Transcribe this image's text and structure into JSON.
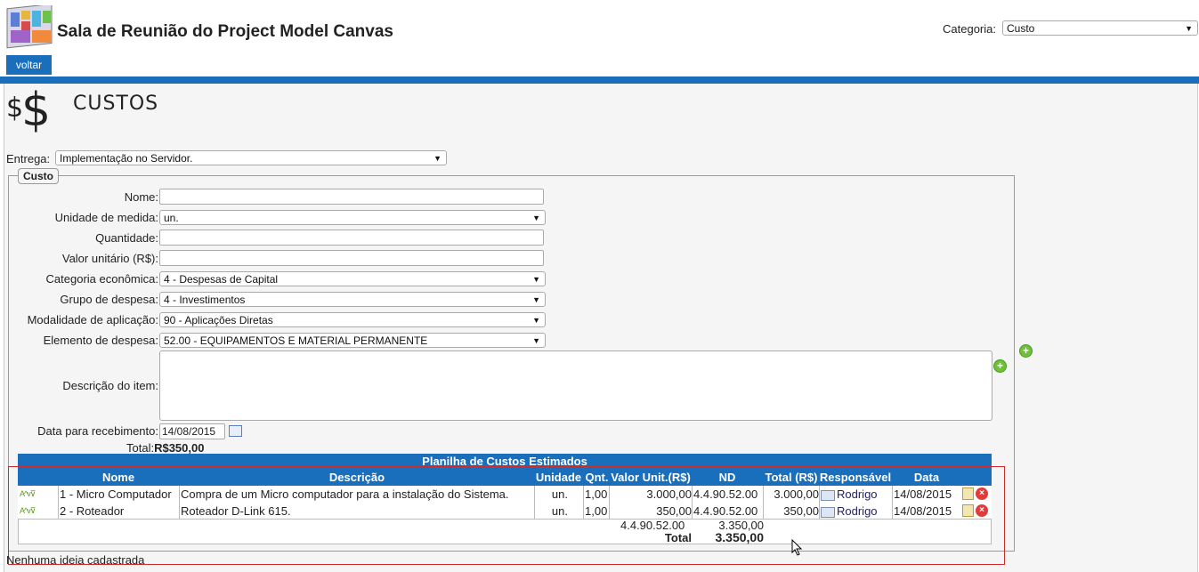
{
  "header": {
    "title": "Sala de Reunião do Project Model Canvas",
    "category_label": "Categoria:",
    "category_value": "Custo",
    "back_button": "voltar"
  },
  "section": {
    "title": "CUSTOS",
    "entrega_label": "Entrega:",
    "entrega_value": "Implementação no Servidor."
  },
  "form": {
    "legend": "Custo",
    "nome_label": "Nome:",
    "unidade_label": "Unidade de medida:",
    "unidade_value": "un.",
    "quantidade_label": "Quantidade:",
    "valor_label": "Valor unitário (R$):",
    "categoria_label": "Categoria econômica:",
    "categoria_value": "4 - Despesas de Capital",
    "grupo_label": "Grupo de despesa:",
    "grupo_value": "4 - Investimentos",
    "modalidade_label": "Modalidade de aplicação:",
    "modalidade_value": "90 - Aplicações Diretas",
    "elemento_label": "Elemento de despesa:",
    "elemento_value": "52.00 - EQUIPAMENTOS E MATERIAL PERMANENTE",
    "descricao_label": "Descrição do item:",
    "data_label": "Data para recebimento:",
    "data_value": "14/08/2015",
    "total_label": "Total:",
    "total_value": "R$350,00"
  },
  "table": {
    "title": "Planilha de Custos Estimados",
    "headers": {
      "nome": "Nome",
      "descricao": "Descrição",
      "unidade": "Unidade",
      "qnt": "Qnt.",
      "valor": "Valor Unit.(R$)",
      "nd": "ND",
      "total": "Total (R$)",
      "responsavel": "Responsável",
      "data": "Data"
    },
    "rows": [
      {
        "nome": "1 - Micro Computador",
        "descricao": "Compra de um Micro computador para a instalação do Sistema.",
        "unidade": "un.",
        "qnt": "1,00",
        "valor": "3.000,00",
        "nd": "4.4.90.52.00",
        "total": "3.000,00",
        "responsavel": "Rodrigo",
        "data": "14/08/2015"
      },
      {
        "nome": "2 - Roteador",
        "descricao": "Roteador D-Link 615.",
        "unidade": "un.",
        "qnt": "1,00",
        "valor": "350,00",
        "nd": "4.4.90.52.00",
        "total": "350,00",
        "responsavel": "Rodrigo",
        "data": "14/08/2015"
      }
    ],
    "summary_nd": "4.4.90.52.00",
    "summary_value": "3.350,00",
    "total_label": "Total",
    "total_value": "3.350,00"
  },
  "empty_message": "Nenhuma ideia cadastrada",
  "colors": {
    "accent": "#1a6fbd",
    "highlight_box": "#cc2b2b"
  }
}
